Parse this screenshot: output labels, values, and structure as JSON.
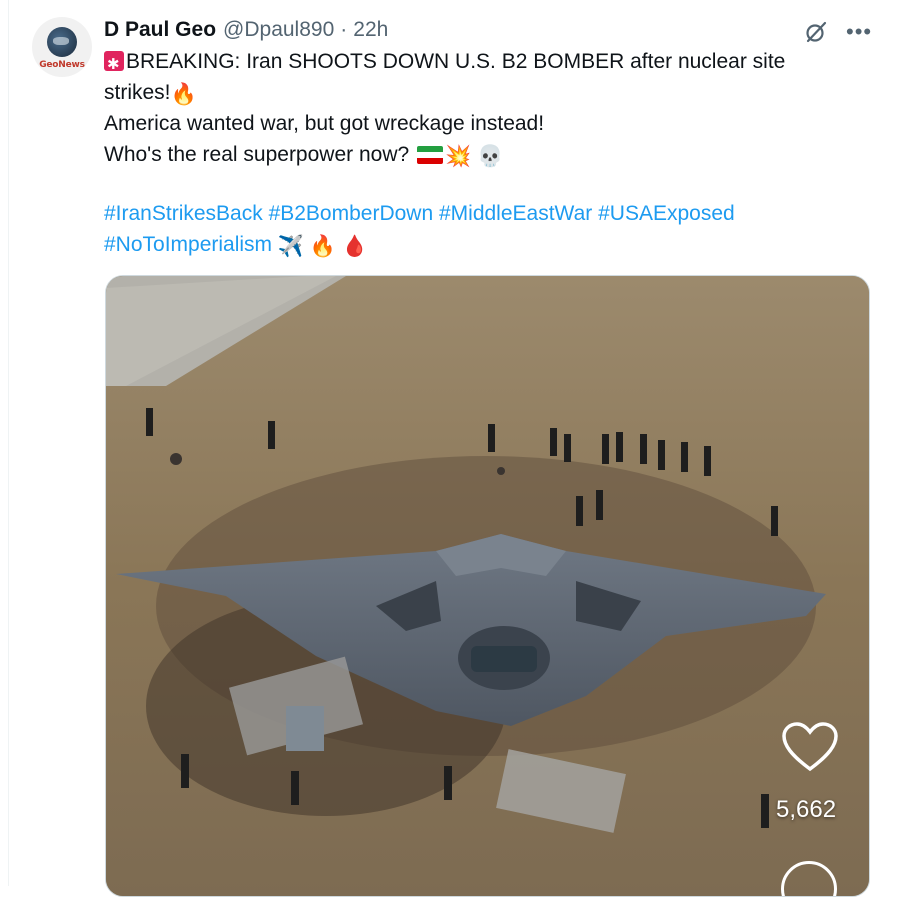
{
  "author": {
    "avatar_text": "GeoNews",
    "name": "D Paul Geo",
    "handle": "@Dpaul890",
    "separator": "·",
    "time": "22h"
  },
  "tweet": {
    "line1": "BREAKING: Iran SHOOTS DOWN U.S. B2 BOMBER after nuclear site strikes!",
    "line2": "America wanted war, but got wreckage instead!",
    "line3": "Who's the real superpower now?",
    "hashtags_line1": "#IranStrikesBack #B2BomberDown #MiddleEastWar #USAExposed",
    "hashtags_line2": "#NoToImperialism",
    "emoji_fire": "🔥",
    "emoji_collision": "💥",
    "emoji_skull": "💀",
    "emoji_plane": "✈️",
    "emoji_drop": "🩸"
  },
  "media": {
    "like_count": "5,662"
  },
  "icons": {
    "avatar": "globe-logo-icon",
    "grok": "grok-slash-icon",
    "more": "more-icon",
    "like": "heart-icon"
  },
  "colors": {
    "link": "#1d9bf0",
    "secondary_text": "#536471",
    "siren": "#e0245e"
  }
}
